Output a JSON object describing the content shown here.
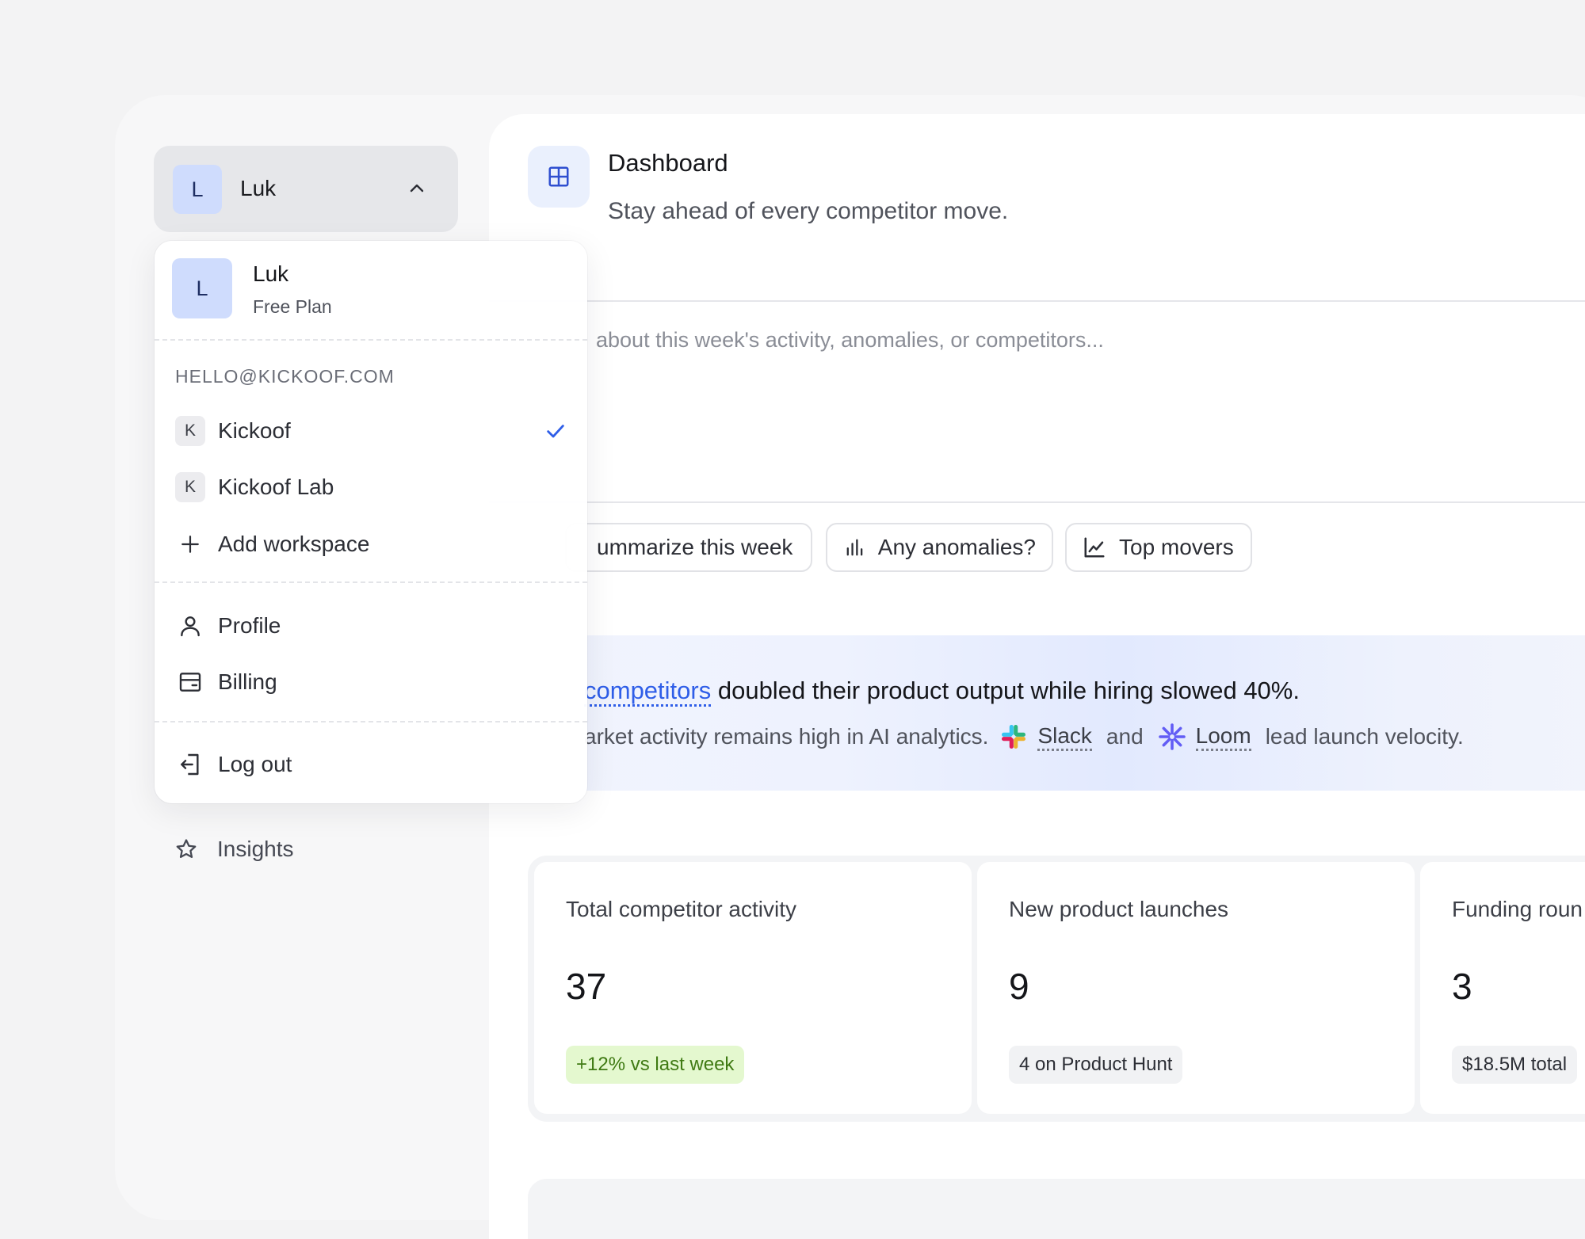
{
  "account": {
    "avatar_letter": "L",
    "name": "Luk"
  },
  "menu": {
    "user": {
      "avatar_letter": "L",
      "name": "Luk",
      "plan": "Free Plan"
    },
    "email": "HELLO@KICKOOF.COM",
    "workspaces": [
      {
        "badge": "K",
        "name": "Kickoof",
        "selected": true
      },
      {
        "badge": "K",
        "name": "Kickoof Lab",
        "selected": false
      }
    ],
    "add_workspace": "Add workspace",
    "profile": "Profile",
    "billing": "Billing",
    "logout": "Log out"
  },
  "sidebar": {
    "insights": "Insights"
  },
  "header": {
    "title": "Dashboard",
    "subtitle": "Stay ahead of every competitor move."
  },
  "prompt": {
    "placeholder": "about this week's activity, anomalies, or competitors..."
  },
  "chips": [
    "ummarize this week",
    "Any anomalies?",
    "Top movers"
  ],
  "insight": {
    "link": "competitors",
    "headline": " doubled their product output while hiring slowed 40%.",
    "sub_prefix": "arket activity remains high in AI analytics.",
    "brand1": "Slack",
    "joiner": "and",
    "brand2": "Loom",
    "sub_suffix": "lead launch velocity."
  },
  "stats": [
    {
      "label": "Total competitor activity",
      "value": "37",
      "badge": "+12% vs last week"
    },
    {
      "label": "New product launches",
      "value": "9",
      "badge": "4 on Product Hunt"
    },
    {
      "label": "Funding roun",
      "value": "3",
      "badge": "$18.5M total"
    }
  ],
  "colors": {
    "accent": "#2f5ee8",
    "positive": "#3f7a13",
    "avatar_bg": "#cfdcfd"
  }
}
